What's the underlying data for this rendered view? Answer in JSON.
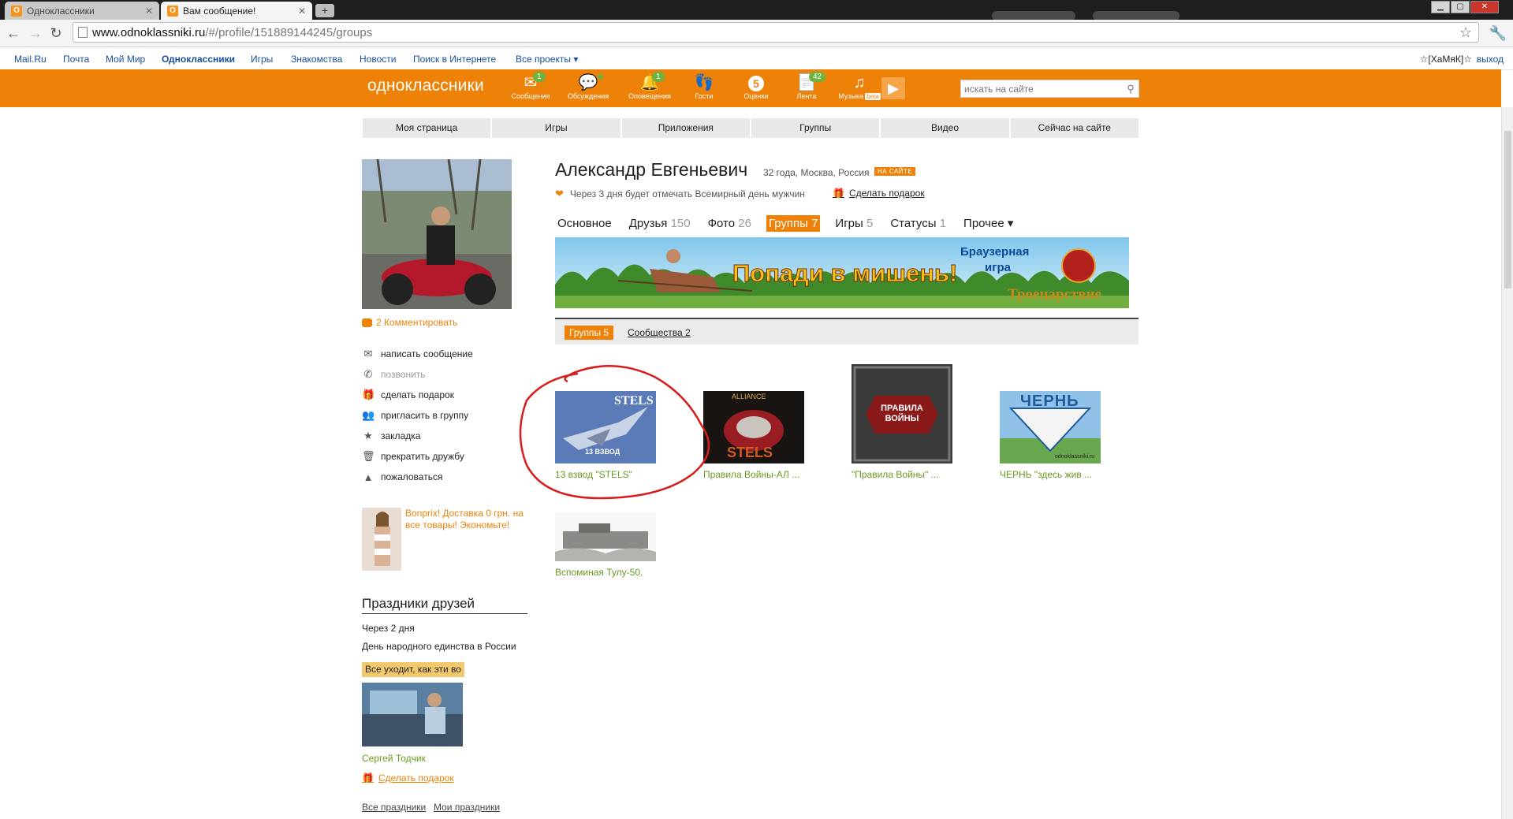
{
  "browser": {
    "tabs": [
      {
        "title": "Одноклассники",
        "active": false
      },
      {
        "title": "Вам сообщение!",
        "active": true
      }
    ],
    "url_domain": "www.odnoklassniki.ru",
    "url_path": "/#/profile/151889144245/groups"
  },
  "mailru_bar": {
    "links": [
      "Mail.Ru",
      "Почта",
      "Мой Мир",
      "Одноклассники",
      "Игры",
      "Знакомства",
      "Новости",
      "Поиск в Интернете",
      "Все проекты ▾"
    ],
    "user_nick": "☆[ХаМяК]☆",
    "logout": "выход"
  },
  "header": {
    "logo": "одноклассники",
    "icons": [
      {
        "label": "Сообщения",
        "badge": "1",
        "icon": "envelope-icon"
      },
      {
        "label": "Обсуждения",
        "badge": "",
        "icon": "chat-icon"
      },
      {
        "label": "Оповещения",
        "badge": "1",
        "icon": "bell-icon"
      },
      {
        "label": "Гости",
        "badge": "",
        "icon": "footprints-icon"
      },
      {
        "label": "Оценки",
        "badge": "",
        "circle": "5",
        "icon": "rating-icon"
      },
      {
        "label": "Лента",
        "badge": "42",
        "icon": "feed-icon"
      },
      {
        "label": "Музыка",
        "badge": "",
        "beta": "beta",
        "icon": "music-icon"
      }
    ],
    "search_placeholder": "искать на сайте"
  },
  "main_nav": [
    "Моя страница",
    "Игры",
    "Приложения",
    "Группы",
    "Видео",
    "Сейчас на сайте"
  ],
  "left": {
    "comment_link": "2 Комментировать",
    "actions": [
      {
        "label": "написать сообщение",
        "icon": "envelope-icon",
        "disabled": false
      },
      {
        "label": "позвонить",
        "icon": "phone-icon",
        "disabled": true
      },
      {
        "label": "сделать подарок",
        "icon": "gift-icon",
        "disabled": false
      },
      {
        "label": "пригласить в группу",
        "icon": "group-icon",
        "disabled": false
      },
      {
        "label": "закладка",
        "icon": "star-icon",
        "disabled": false
      },
      {
        "label": "прекратить дружбу",
        "icon": "trash-icon",
        "disabled": false
      },
      {
        "label": "пожаловаться",
        "icon": "warning-icon",
        "disabled": false
      }
    ],
    "ad_text": "Bonprix! Доставка 0 грн. на все товары! Экономьте!",
    "holidays": {
      "title": "Праздники друзей",
      "when": "Через 2 дня",
      "name": "День народного единства в России",
      "badge": "Все уходит, как эти во",
      "friend": "Сергей Тодчик",
      "gift_link": "Сделать подарок",
      "all_link": "Все праздники",
      "my_link": "Мои праздники"
    }
  },
  "profile": {
    "name": "Александр Евгеньевич",
    "meta": "32 года, Москва, Россия",
    "online_badge": "НА САЙТЕ",
    "event": "Через 3 дня будет отмечать Всемирный день мужчин",
    "event_gift": "Сделать подарок",
    "tabs": [
      {
        "label": "Основное",
        "count": "",
        "active": false
      },
      {
        "label": "Друзья",
        "count": "150",
        "active": false
      },
      {
        "label": "Фото",
        "count": "26",
        "active": false
      },
      {
        "label": "Группы",
        "count": "7",
        "active": true
      },
      {
        "label": "Игры",
        "count": "5",
        "active": false
      },
      {
        "label": "Статусы",
        "count": "1",
        "active": false
      },
      {
        "label": "Прочее ▾",
        "count": "",
        "active": false
      }
    ],
    "banner": {
      "text": "Попади в мишень!",
      "side_line1": "Браузерная",
      "side_line2": "игра",
      "brand": "Троецарствие"
    },
    "subtabs": {
      "groups": "Группы 5",
      "communities": "Сообщества 2"
    },
    "groups": [
      {
        "name": "13 взвод \"STELS\"",
        "thumb_text": "STELS",
        "thumb_sub": "13 ВЗВОД"
      },
      {
        "name": "Правила Войны-АЛ ...",
        "thumb_text": "ALLIANCE",
        "thumb_sub": "STELS"
      },
      {
        "name": "\"Правила Войны\" ...",
        "thumb_text": "ПРАВИЛА ВОЙНЫ",
        "thumb_sub": ""
      },
      {
        "name": "ЧЕРНЬ \"здесь жив ...",
        "thumb_text": "ЧЕРНЬ",
        "thumb_sub": "odnoklassniki.ru"
      },
      {
        "name": "Вспоминая Тулу-50.",
        "thumb_text": "",
        "thumb_sub": ""
      }
    ]
  },
  "colors": {
    "accent": "#ee8208",
    "link_green": "#6a9a1f",
    "link_blue": "#1a4fa0"
  }
}
